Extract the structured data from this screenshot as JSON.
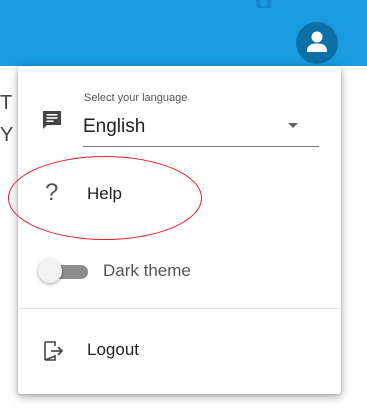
{
  "header": {
    "title_fragment": "g",
    "accent_color": "#1a9bdf",
    "account_icon": "account-circle-icon"
  },
  "background_text": [
    "T",
    "Y"
  ],
  "menu": {
    "language": {
      "icon": "message-icon",
      "caption": "Select your language",
      "selected": "English"
    },
    "help": {
      "icon": "question-mark-icon",
      "label": "Help"
    },
    "theme": {
      "label": "Dark theme",
      "enabled": false
    },
    "logout": {
      "icon": "logout-icon",
      "label": "Logout"
    }
  },
  "annotation": {
    "color": "#e0222a"
  }
}
